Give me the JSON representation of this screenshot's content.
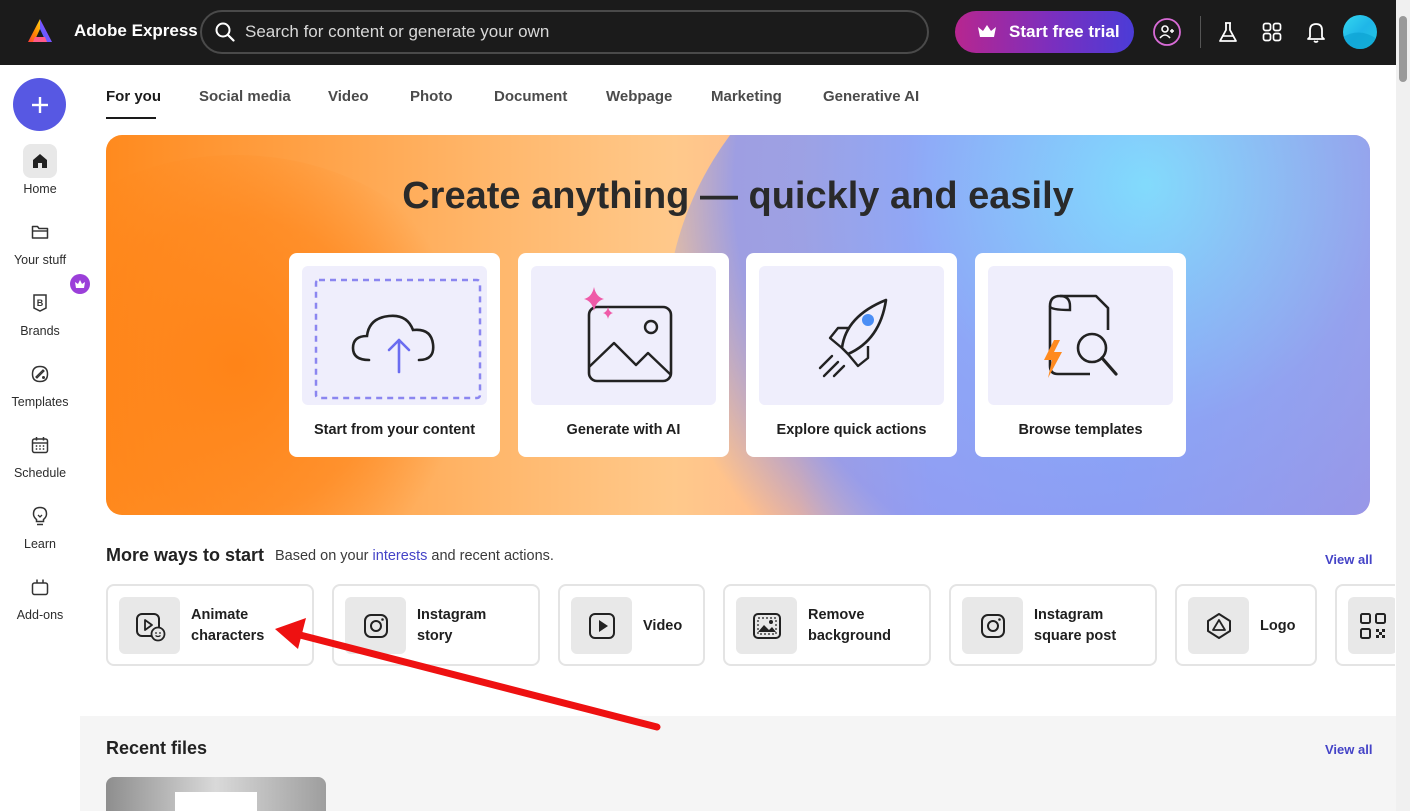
{
  "header": {
    "app_title": "Adobe Express",
    "search_placeholder": "Search for content or generate your own",
    "trial_button": "Start free trial"
  },
  "sidebar": {
    "items": [
      {
        "label": "Home",
        "icon": "home-icon"
      },
      {
        "label": "Your stuff",
        "icon": "folder-icon"
      },
      {
        "label": "Brands",
        "icon": "brand-icon"
      },
      {
        "label": "Templates",
        "icon": "templates-icon"
      },
      {
        "label": "Schedule",
        "icon": "calendar-icon"
      },
      {
        "label": "Learn",
        "icon": "lightbulb-icon"
      },
      {
        "label": "Add-ons",
        "icon": "addons-icon"
      }
    ]
  },
  "tabs": [
    "For you",
    "Social media",
    "Video",
    "Photo",
    "Document",
    "Webpage",
    "Marketing",
    "Generative AI"
  ],
  "hero": {
    "title": "Create anything — quickly and easily",
    "cards": [
      "Start from your content",
      "Generate with AI",
      "Explore quick actions",
      "Browse templates"
    ]
  },
  "more_ways": {
    "title": "More ways to start",
    "subtitle_prefix": "Based on your",
    "subtitle_link": "interests",
    "subtitle_suffix": "and recent actions.",
    "view_all": "View all",
    "items": [
      {
        "line1": "Animate",
        "line2": "characters",
        "icon": "animate-icon"
      },
      {
        "line1": "Instagram",
        "line2": "story",
        "icon": "instagram-icon"
      },
      {
        "line1": "Video",
        "line2": "",
        "icon": "play-icon"
      },
      {
        "line1": "Remove",
        "line2": "background",
        "icon": "remove-bg-icon"
      },
      {
        "line1": "Instagram",
        "line2": "square post",
        "icon": "instagram-icon"
      },
      {
        "line1": "Logo",
        "line2": "",
        "icon": "logo-icon"
      }
    ]
  },
  "recent": {
    "title": "Recent files",
    "view_all": "View all"
  },
  "colors": {
    "accent": "#5758e3",
    "link": "#4443c7",
    "topbar": "#1b1b1b",
    "annotation_arrow": "#ee1111"
  }
}
